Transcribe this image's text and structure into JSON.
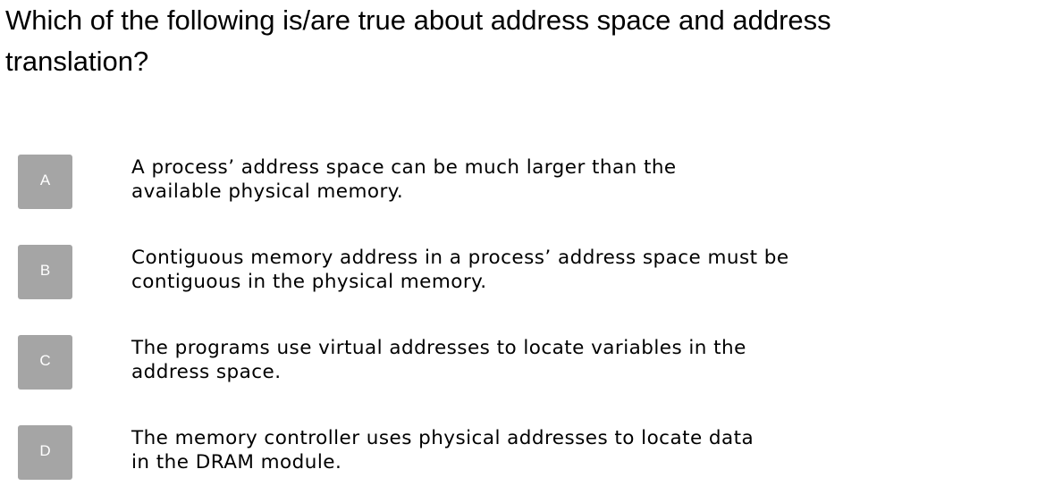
{
  "question": {
    "line1": "Which of the following is/are true about address space and address",
    "line2": "translation?"
  },
  "options": [
    {
      "letter": "A",
      "line1": "A process’ address space can be much larger than the",
      "line2": "available physical memory."
    },
    {
      "letter": "B",
      "line1": "Contiguous memory address in a process’ address space must be",
      "line2": "contiguous in the physical memory."
    },
    {
      "letter": "C",
      "line1": "The programs use virtual addresses to locate variables in the",
      "line2": "address space."
    },
    {
      "letter": "D",
      "line1": "The memory controller uses physical addresses to locate data",
      "line2": "in the DRAM module."
    }
  ],
  "colors": {
    "letter_box_background": "#a5a5a5",
    "letter_text": "#ffffff",
    "text": "#000000"
  }
}
